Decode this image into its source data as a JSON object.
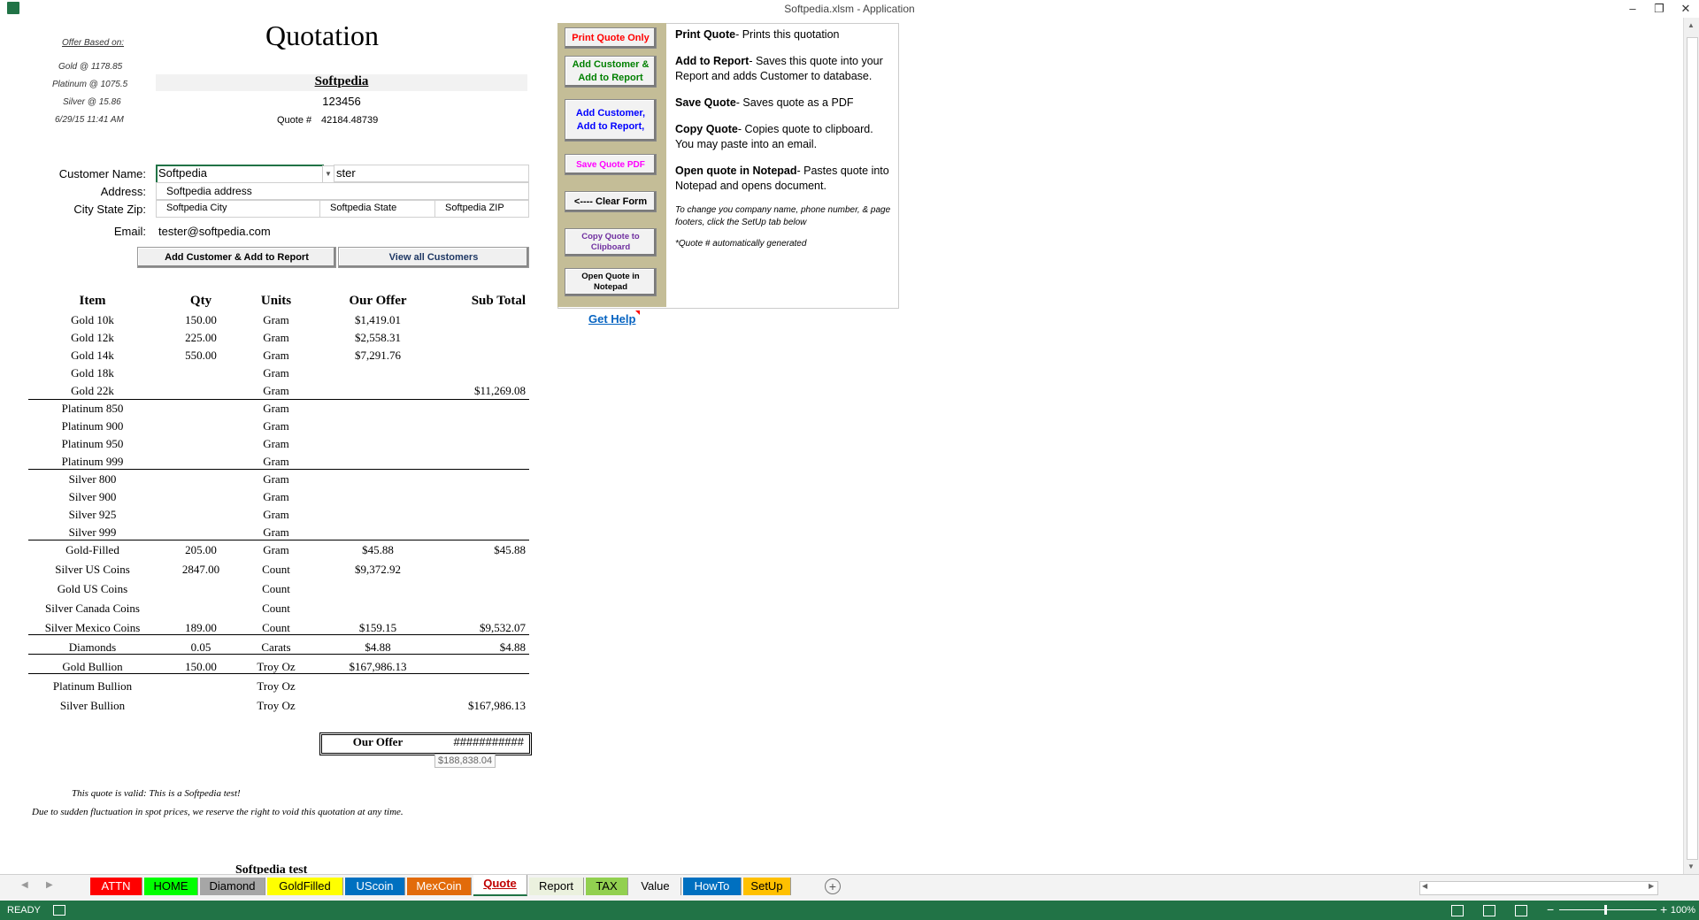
{
  "window": {
    "title": "Softpedia.xlsm - Application",
    "minimize": "–",
    "restore": "❐",
    "close": "✕"
  },
  "offer_info": {
    "heading": "Offer Based on:",
    "gold": "Gold @ 1178.85",
    "platinum": "Platinum @ 1075.5",
    "silver": "Silver @ 15.86",
    "datetime": "6/29/15 11:41 AM"
  },
  "quote": {
    "title": "Quotation",
    "company": "Softpedia",
    "phone": "123456",
    "quote_no_label": "Quote #",
    "quote_no": "42184.48739"
  },
  "customer": {
    "name_label": "Customer Name:",
    "name_value": "Softpedia",
    "name_extra": "ster",
    "address_label": "Address:",
    "address_value": "Softpedia address",
    "csz_label": "City State Zip:",
    "city": "Softpedia City",
    "state": "Softpedia State",
    "zip": "Softpedia ZIP",
    "email_label": "Email:",
    "email_value": "tester@softpedia.com",
    "add_button": "Add Customer & Add to Report",
    "view_button": "View all Customers"
  },
  "table": {
    "headers": {
      "item": "Item",
      "qty": "Qty",
      "units": "Units",
      "offer": "Our Offer",
      "sub": "Sub Total"
    },
    "rows": [
      {
        "item": "Gold 10k",
        "qty": "150.00",
        "unit": "Gram",
        "offer": "$1,419.01",
        "sub": ""
      },
      {
        "item": "Gold 12k",
        "qty": "225.00",
        "unit": "Gram",
        "offer": "$2,558.31",
        "sub": ""
      },
      {
        "item": "Gold 14k",
        "qty": "550.00",
        "unit": "Gram",
        "offer": "$7,291.76",
        "sub": ""
      },
      {
        "item": "Gold 18k",
        "qty": "",
        "unit": "Gram",
        "offer": "",
        "sub": ""
      },
      {
        "item": "Gold 22k",
        "qty": "",
        "unit": "Gram",
        "offer": "",
        "sub": "$11,269.08"
      },
      {
        "item": "Platinum 850",
        "qty": "",
        "unit": "Gram",
        "offer": "",
        "sub": ""
      },
      {
        "item": "Platinum 900",
        "qty": "",
        "unit": "Gram",
        "offer": "",
        "sub": ""
      },
      {
        "item": "Platinum 950",
        "qty": "",
        "unit": "Gram",
        "offer": "",
        "sub": ""
      },
      {
        "item": "Platinum 999",
        "qty": "",
        "unit": "Gram",
        "offer": "",
        "sub": ""
      },
      {
        "item": "Silver 800",
        "qty": "",
        "unit": "Gram",
        "offer": "",
        "sub": ""
      },
      {
        "item": "Silver 900",
        "qty": "",
        "unit": "Gram",
        "offer": "",
        "sub": ""
      },
      {
        "item": "Silver 925",
        "qty": "",
        "unit": "Gram",
        "offer": "",
        "sub": ""
      },
      {
        "item": "Silver 999",
        "qty": "",
        "unit": "Gram",
        "offer": "",
        "sub": ""
      },
      {
        "item": "Gold-Filled",
        "qty": "205.00",
        "unit": "Gram",
        "offer": "$45.88",
        "sub": "$45.88"
      },
      {
        "item": "Silver US Coins",
        "qty": "2847.00",
        "unit": "Count",
        "offer": "$9,372.92",
        "sub": ""
      },
      {
        "item": "Gold US Coins",
        "qty": "",
        "unit": "Count",
        "offer": "",
        "sub": ""
      },
      {
        "item": "Silver Canada Coins",
        "qty": "",
        "unit": "Count",
        "offer": "",
        "sub": ""
      },
      {
        "item": "Silver Mexico Coins",
        "qty": "189.00",
        "unit": "Count",
        "offer": "$159.15",
        "sub": "$9,532.07"
      },
      {
        "item": "Diamonds",
        "qty": "0.05",
        "unit": "Carats",
        "offer": "$4.88",
        "sub": "$4.88"
      },
      {
        "item": "Gold Bullion",
        "qty": "150.00",
        "unit": "Troy Oz",
        "offer": "$167,986.13",
        "sub": ""
      },
      {
        "item": "Platinum Bullion",
        "qty": "",
        "unit": "Troy Oz",
        "offer": "",
        "sub": ""
      },
      {
        "item": "Silver Bullion",
        "qty": "",
        "unit": "Troy Oz",
        "offer": "",
        "sub": "$167,986.13"
      }
    ],
    "total_label": "Our Offer",
    "total_value": "###########",
    "total_tooltip": "$188,838.04"
  },
  "footer": {
    "valid": "This quote is valid:  This is a Softpedia test!",
    "disclaimer": "Due to sudden fluctuation in spot prices, we reserve the right to void this quotation at any time.",
    "sign": "Softpedia test"
  },
  "panel": {
    "buttons": [
      "Print Quote Only",
      "Add Customer & Add to Report",
      "Add Customer, Add to Report,",
      "Save Quote PDF",
      "<---- Clear Form",
      "Copy Quote to Clipboard",
      "Open Quote in Notepad"
    ],
    "get_help": "Get Help",
    "help": [
      {
        "title": "Print Quote",
        "text": "- Prints this quotation"
      },
      {
        "title": "Add to Report",
        "text": "- Saves this  quote into your Report  and adds Customer to database."
      },
      {
        "title": "Save Quote",
        "text": "- Saves quote as a PDF"
      },
      {
        "title": "Copy Quote",
        "text": "- Copies quote to clipboard. You may paste into an email."
      },
      {
        "title": "Open quote in Notepad",
        "text": "- Pastes quote into Notepad and opens document."
      }
    ],
    "note": "To  change you company name, phone number, & page footers, click the SetUp tab below",
    "note2": "*Quote # automatically generated"
  },
  "tabs": [
    {
      "label": "ATTN",
      "bg": "#ff0000",
      "fg": "#ffffff"
    },
    {
      "label": "HOME",
      "bg": "#00ff00",
      "fg": "#000000"
    },
    {
      "label": "Diamond",
      "bg": "#a6a6a6",
      "fg": "#000000"
    },
    {
      "label": "GoldFilled",
      "bg": "#ffff00",
      "fg": "#000000"
    },
    {
      "label": "UScoin",
      "bg": "#0070c0",
      "fg": "#ffffff"
    },
    {
      "label": "MexCoin",
      "bg": "#e26b0a",
      "fg": "#ffffff"
    },
    {
      "label": "Quote",
      "bg": "#ffffff",
      "fg": "#c00000"
    },
    {
      "label": "Report",
      "bg": "#ebf1de",
      "fg": "#000000"
    },
    {
      "label": "TAX",
      "bg": "#92d050",
      "fg": "#000000"
    },
    {
      "label": "Value",
      "bg": "#f3f3f3",
      "fg": "#000000"
    },
    {
      "label": "HowTo",
      "bg": "#0070c0",
      "fg": "#ffffff"
    },
    {
      "label": "SetUp",
      "bg": "#ffc000",
      "fg": "#000000"
    }
  ],
  "status": {
    "ready": "READY",
    "zoom": "100%"
  }
}
